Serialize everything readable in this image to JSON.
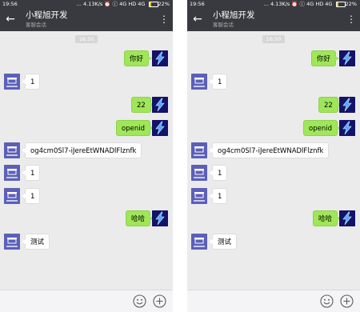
{
  "status_bar": {
    "time": "19:56",
    "right_text": "... 4.13K/s ⏰ ⓘ 4G HD 4G",
    "battery": "22%"
  },
  "header": {
    "title": "小程旭开发",
    "subtitle": "客服会话",
    "back_icon": "arrow-left-icon",
    "more_icon": "more-vertical-icon"
  },
  "timestamp": "16:50",
  "messages": [
    {
      "side": "out",
      "text": "你好"
    },
    {
      "side": "in",
      "text": "1"
    },
    {
      "side": "out",
      "text": "22"
    },
    {
      "side": "out",
      "text": "openid"
    },
    {
      "side": "in",
      "text": "og4cm0Sl7-iJereEtWNADlFlznfk"
    },
    {
      "side": "in",
      "text": "1"
    },
    {
      "side": "in",
      "text": "1"
    },
    {
      "side": "out",
      "text": "哈哈"
    },
    {
      "side": "in",
      "text": "测试"
    }
  ],
  "avatar_text": "在线门店",
  "bottom_bar": {
    "emoji_icon": "emoji-icon",
    "plus_icon": "plus-circle-icon"
  },
  "colors": {
    "header_bg": "#393a3f",
    "chat_bg": "#ebebeb",
    "outgoing_bubble": "#9fe658",
    "incoming_bubble": "#ffffff",
    "bot_avatar": "#1a1a6e",
    "shop_avatar": "#5b5fb8"
  }
}
